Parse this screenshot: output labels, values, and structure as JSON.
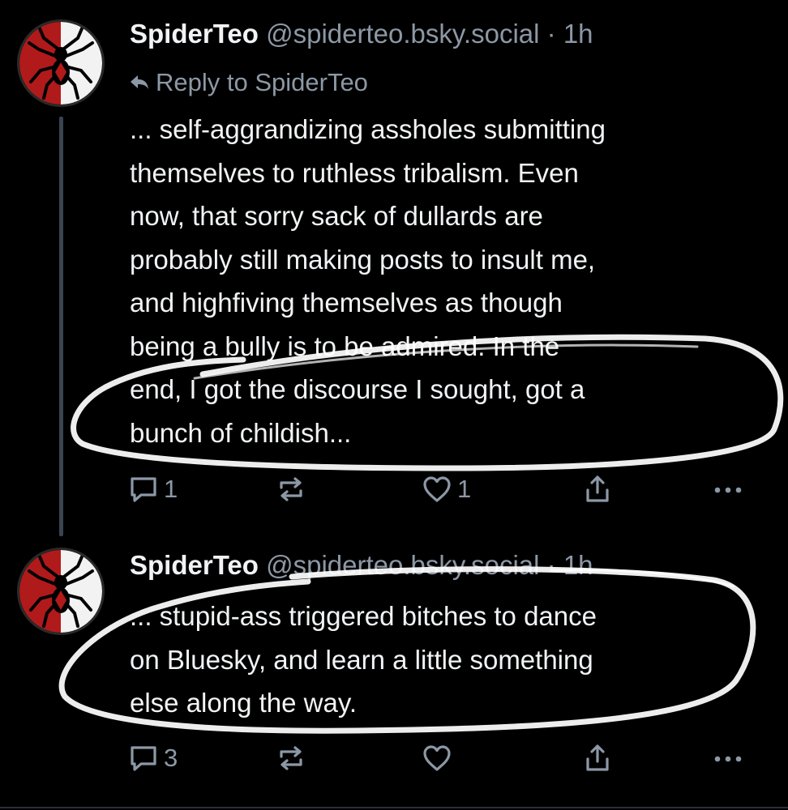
{
  "colors": {
    "background": "#000000",
    "text": "#f1f3f5",
    "muted": "#8d98a6",
    "thread": "#3a4450",
    "scribble": "#ffffff",
    "avatar_red": "#b11a1a"
  },
  "posts": [
    {
      "author": "SpiderTeo",
      "handle": "@spiderteo.bsky.social",
      "separator": "·",
      "time": "1h",
      "reply_to": "Reply to SpiderTeo",
      "text": "... self-aggrandizing assholes submitting\nthemselves to ruthless tribalism. Even\nnow, that sorry sack of dullards are\nprobably still making posts to insult me,\nand highfiving themselves as though\nbeing a bully is to be admired. In the\nend, I got the discourse I sought, got a\nbunch of childish...",
      "reply_count": "1",
      "repost_count": "",
      "like_count": "1",
      "icons": [
        "reply-icon",
        "repost-icon",
        "like-icon",
        "share-icon",
        "more-icon"
      ]
    },
    {
      "author": "SpiderTeo",
      "handle": "@spiderteo.bsky.social",
      "separator": "·",
      "time": "1h",
      "text": "... stupid-ass triggered bitches to dance\non Bluesky, and learn a little something\nelse along the way.",
      "reply_count": "3",
      "repost_count": "",
      "like_count": "",
      "icons": [
        "reply-icon",
        "repost-icon",
        "like-icon",
        "share-icon",
        "more-icon"
      ]
    }
  ]
}
